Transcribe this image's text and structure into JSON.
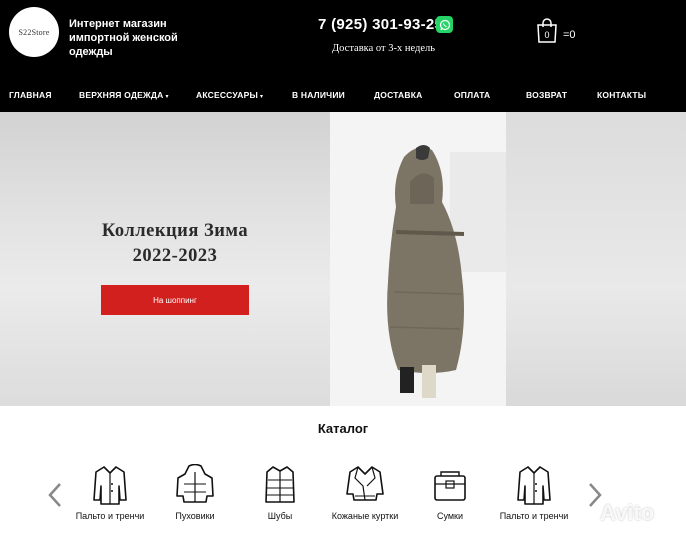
{
  "header": {
    "logo_text": "S22Store",
    "tagline": "Интернет магазин импортной женской одежды",
    "phone": "7 (925) 301-93-25",
    "delivery": "Доставка от 3-х недель",
    "cart_count": "=0"
  },
  "nav": [
    {
      "label": "ГЛАВНАЯ"
    },
    {
      "label": "ВЕРХНЯЯ ОДЕЖДА"
    },
    {
      "label": "АКСЕССУАРЫ"
    },
    {
      "label": "В НАЛИЧИИ"
    },
    {
      "label": "ДОСТАВКА"
    },
    {
      "label": "ОПЛАТА"
    },
    {
      "label": "ВОЗВРАТ"
    },
    {
      "label": "КОНТАКТЫ"
    }
  ],
  "hero": {
    "title_line1": "Коллекция Зима",
    "title_line2": "2022-2023",
    "button": "На шоппинг"
  },
  "catalog": {
    "title": "Каталог",
    "items": [
      {
        "label": "Пальто и тренчи",
        "icon": "coat-icon"
      },
      {
        "label": "Пуховики",
        "icon": "puffer-jacket-icon"
      },
      {
        "label": "Шубы",
        "icon": "fur-coat-icon"
      },
      {
        "label": "Кожаные куртки",
        "icon": "leather-jacket-icon"
      },
      {
        "label": "Сумки",
        "icon": "bag-icon"
      },
      {
        "label": "Пальто и тренчи",
        "icon": "coat-icon"
      }
    ]
  },
  "watermark": "Avito",
  "colors": {
    "header_bg": "#000000",
    "accent_button": "#d2201f",
    "whatsapp": "#25d366"
  }
}
